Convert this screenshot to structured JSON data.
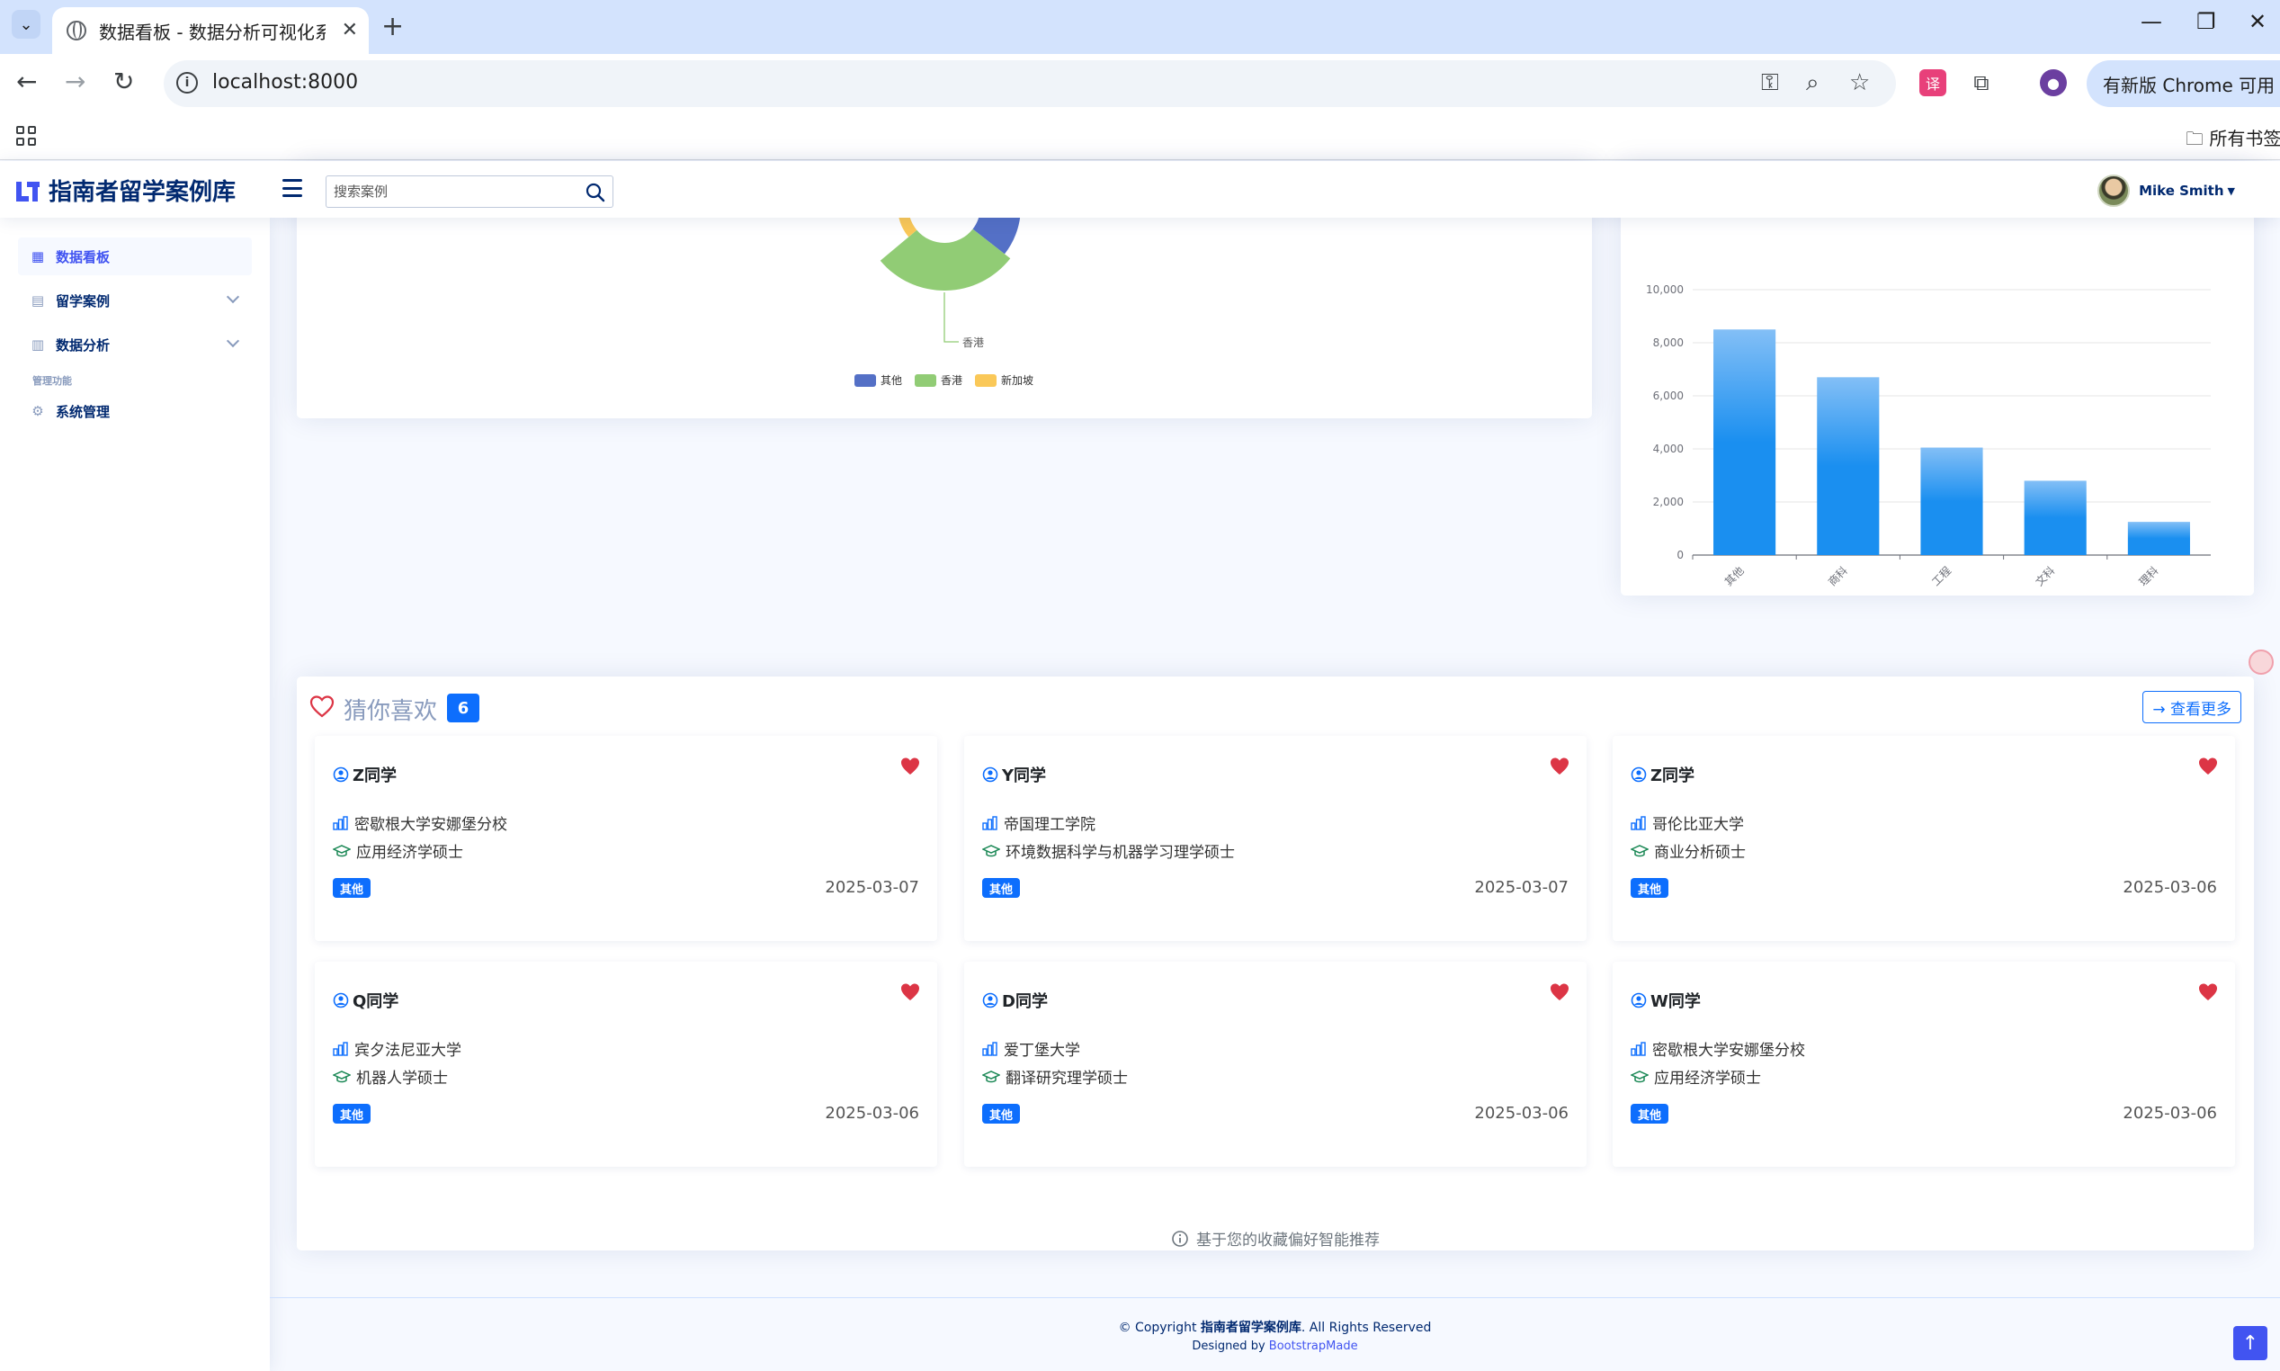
{
  "browser": {
    "tab_title": "数据看板 - 数据分析可视化系统",
    "url": "localhost:8000",
    "update_label": "有新版 Chrome 可用",
    "bookmarks_all": "所有书签"
  },
  "header": {
    "logo_text": "指南者留学案例库",
    "search_placeholder": "搜索案例",
    "user_name": "Mike Smith"
  },
  "sidebar": {
    "items": [
      {
        "label": "数据看板",
        "icon": "grid-icon"
      },
      {
        "label": "留学案例",
        "icon": "document-icon"
      },
      {
        "label": "数据分析",
        "icon": "bar-chart-icon"
      }
    ],
    "heading": "管理功能",
    "admin_item": {
      "label": "系统管理",
      "icon": "gear-icon"
    }
  },
  "chart_data": [
    {
      "type": "pie",
      "variant": "rose-donut",
      "slices": [
        {
          "label": "其他",
          "color": "#5470c6"
        },
        {
          "label": "香港",
          "color": "#91cc75"
        },
        {
          "label": "新加坡",
          "color": "#fac858"
        }
      ],
      "callout_label": "香港",
      "legend": [
        "其他",
        "香港",
        "新加坡"
      ],
      "legend_position": "bottom"
    },
    {
      "type": "bar",
      "categories": [
        "其他",
        "商科",
        "工程",
        "文科",
        "理科"
      ],
      "values": [
        8500,
        6700,
        4050,
        2800,
        1250
      ],
      "yticks": [
        "0",
        "2,000",
        "4,000",
        "6,000",
        "8,000",
        "10,000"
      ],
      "ylim": [
        0,
        10000
      ],
      "grid": true,
      "color": "#1a8ff0"
    }
  ],
  "favorites": {
    "title": "猜你喜欢",
    "count": "6",
    "more_label": "→ 查看更多",
    "hint": "基于您的收藏偏好智能推荐",
    "items": [
      {
        "name": "Z同学",
        "school": "密歇根大学安娜堡分校",
        "program": "应用经济学硕士",
        "tag": "其他",
        "date": "2025-03-07"
      },
      {
        "name": "Y同学",
        "school": "帝国理工学院",
        "program": "环境数据科学与机器学习理学硕士",
        "tag": "其他",
        "date": "2025-03-07"
      },
      {
        "name": "Z同学",
        "school": "哥伦比亚大学",
        "program": "商业分析硕士",
        "tag": "其他",
        "date": "2025-03-06"
      },
      {
        "name": "Q同学",
        "school": "宾夕法尼亚大学",
        "program": "机器人学硕士",
        "tag": "其他",
        "date": "2025-03-06"
      },
      {
        "name": "D同学",
        "school": "爱丁堡大学",
        "program": "翻译研究理学硕士",
        "tag": "其他",
        "date": "2025-03-06"
      },
      {
        "name": "W同学",
        "school": "密歇根大学安娜堡分校",
        "program": "应用经济学硕士",
        "tag": "其他",
        "date": "2025-03-06"
      }
    ]
  },
  "footer": {
    "copyright_prefix": "© Copyright ",
    "copyright_brand": "指南者留学案例库",
    "copyright_suffix": ". All Rights Reserved",
    "designed_by": "Designed by ",
    "designer": "BootstrapMade"
  }
}
